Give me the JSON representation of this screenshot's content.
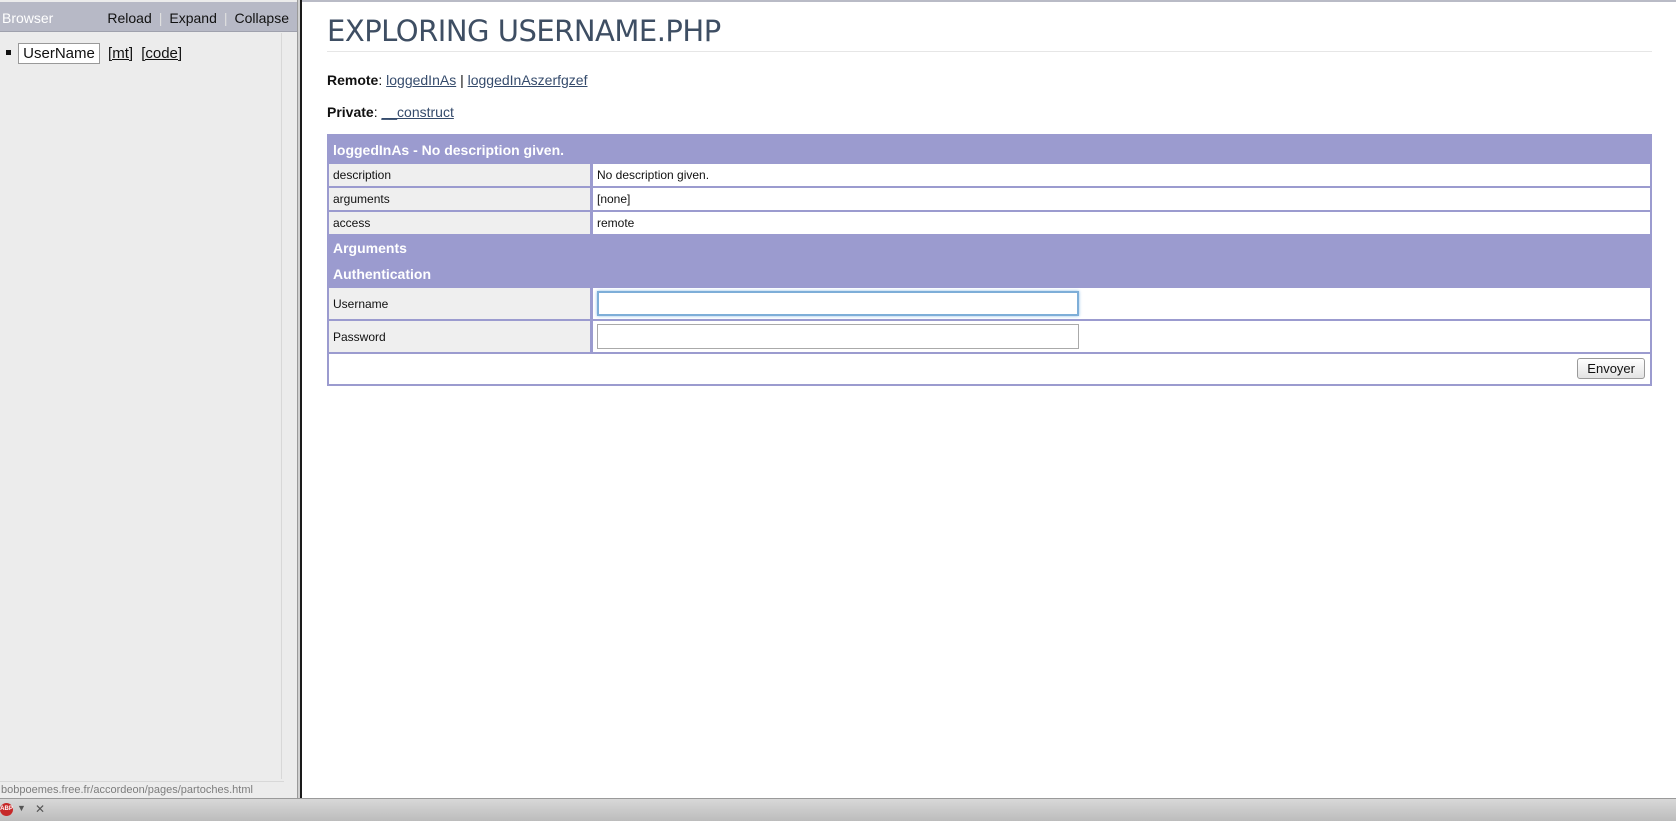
{
  "sidebar": {
    "title": "Browser",
    "actions": [
      "Reload",
      "Expand",
      "Collapse"
    ],
    "tree": {
      "node_label": "UserName",
      "link_mt": "[mt]",
      "link_code": "[code]"
    },
    "status_url": "bobpoemes.free.fr/accordeon/pages/partoches.html"
  },
  "main": {
    "title": "EXPLORING USERNAME.PHP",
    "remote": {
      "label": "Remote",
      "methods": [
        "loggedInAs",
        "loggedInAszerfgzef"
      ],
      "separator": "|"
    },
    "private": {
      "label": "Private",
      "methods": [
        "__construct"
      ]
    },
    "method_panel": {
      "header": "loggedInAs - No description given.",
      "rows": [
        {
          "key": "description",
          "value": "No description given."
        },
        {
          "key": "arguments",
          "value": "[none]"
        },
        {
          "key": "access",
          "value": "remote"
        }
      ],
      "arguments_heading": "Arguments",
      "auth_heading": "Authentication",
      "fields": [
        {
          "label": "Username",
          "value": "",
          "focused": true
        },
        {
          "label": "Password",
          "value": "",
          "focused": false
        }
      ],
      "submit_label": "Envoyer"
    }
  },
  "statusbar": {
    "addon_icon": "adblock-icon",
    "addon_badge": "ABP",
    "close_glyph": "✕"
  },
  "colors": {
    "panel_accent": "#9b9bcf",
    "title": "#3e4e63",
    "sidebar_header": "#b7b9c6",
    "link": "#354b6c"
  }
}
